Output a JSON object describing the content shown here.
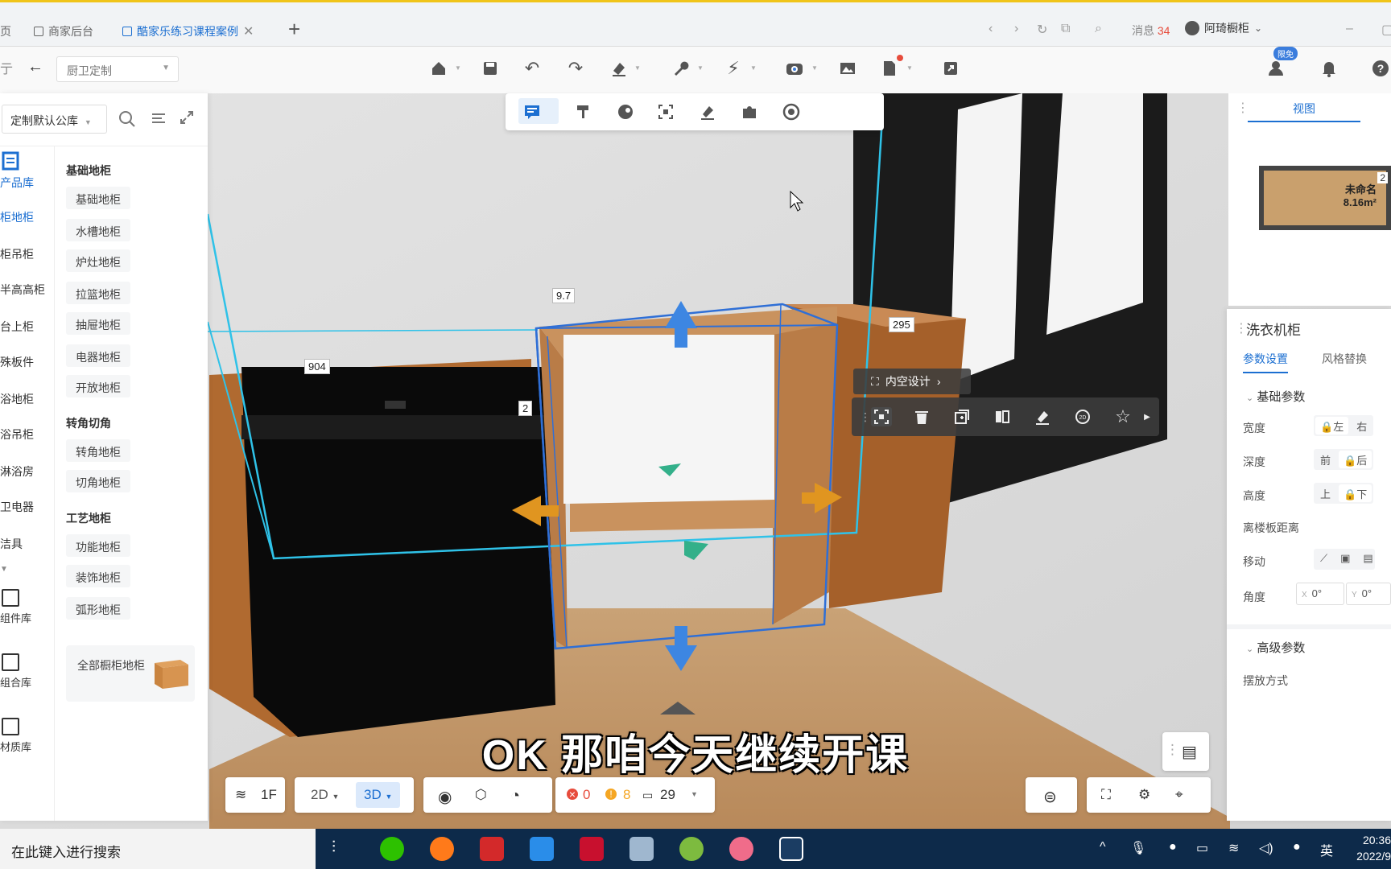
{
  "browser": {
    "tabs": [
      {
        "label": "页"
      },
      {
        "label": "商家后台"
      },
      {
        "label": "酷家乐练习课程案例"
      }
    ],
    "new_tab": "+",
    "messages_label": "消息",
    "messages_count": "34",
    "user_name": "阿琦橱柜"
  },
  "toolbar": {
    "category_select": "厨卫定制",
    "limited_badge": "限免"
  },
  "library": {
    "source_select": "定制默认公库",
    "nav": [
      {
        "label": "产品库",
        "active": true
      },
      {
        "label": "柜地柜",
        "active": true
      },
      {
        "label": "柜吊柜"
      },
      {
        "label": "半高高柜"
      },
      {
        "label": "台上柜"
      },
      {
        "label": "殊板件"
      },
      {
        "label": "浴地柜"
      },
      {
        "label": "浴吊柜"
      },
      {
        "label": "淋浴房"
      },
      {
        "label": "卫电器"
      },
      {
        "label": "洁具"
      }
    ],
    "nav_blocks": [
      {
        "label": "组件库"
      },
      {
        "label": "组合库"
      },
      {
        "label": "材质库"
      }
    ],
    "categories": [
      {
        "title": "基础地柜",
        "items": [
          "基础地柜",
          "水槽地柜",
          "炉灶地柜",
          "拉篮地柜",
          "抽屉地柜",
          "电器地柜",
          "开放地柜"
        ]
      },
      {
        "title": "转角切角",
        "items": [
          "转角地柜",
          "切角地柜"
        ]
      },
      {
        "title": "工艺地柜",
        "items": [
          "功能地柜",
          "装饰地柜",
          "弧形地柜"
        ]
      }
    ],
    "all_cabinets_label": "全部橱柜地柜"
  },
  "view_panel": {
    "tab": "视图",
    "minimap_name": "未命名",
    "minimap_area": "8.16m²",
    "minimap_marker": "2"
  },
  "properties": {
    "title": "洗衣机柜",
    "tabs": [
      "参数设置",
      "风格替换"
    ],
    "basic_section": "基础参数",
    "rows": {
      "width": {
        "label": "宽度",
        "a": "左",
        "b": "右"
      },
      "depth": {
        "label": "深度",
        "a": "前",
        "b": "后"
      },
      "height": {
        "label": "高度",
        "a": "上",
        "b": "下"
      },
      "floor_dist": {
        "label": "离楼板距离"
      },
      "move": {
        "label": "移动"
      },
      "angle": {
        "label": "角度",
        "x_axis": "X",
        "x_value": "0°",
        "y_axis": "Y",
        "y_value": "0°"
      }
    },
    "advanced_section": "高级参数",
    "placement_label": "摆放方式"
  },
  "scene": {
    "inner_design_label": "内空设计",
    "dims": {
      "d1": "904",
      "d2": "9.7",
      "d3": "295",
      "d4": "2"
    },
    "cursor": "pointer"
  },
  "bottom_bar": {
    "floor": "1F",
    "mode_2d": "2D",
    "mode_3d": "3D",
    "error_count": "0",
    "warning_count": "8",
    "info_count": "29"
  },
  "subtitle": "OK 那咱今天继续开课",
  "taskbar": {
    "search_placeholder": "在此键入进行搜索",
    "ime": "英",
    "time": "20:36",
    "date": "2022/9"
  },
  "colors": {
    "accent": "#1c6fd1",
    "selection_outline": "#2f8be0",
    "room_box": "#2fc2e8",
    "wood": "#b8743c",
    "error": "#e74c3c",
    "warning": "#f5a623"
  }
}
